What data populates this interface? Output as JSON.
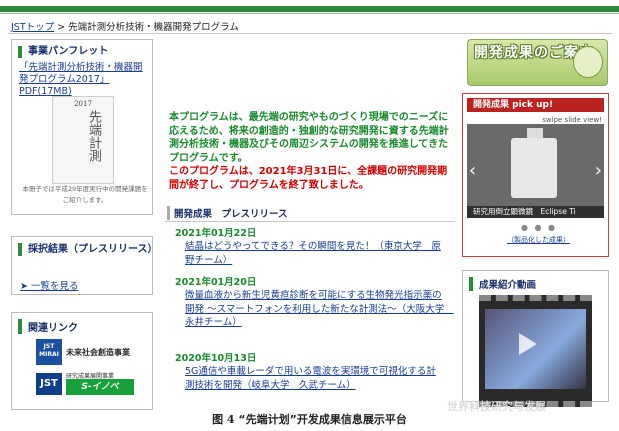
{
  "breadcrumb": {
    "home": "JSTトップ",
    "sep": " > ",
    "current": "先端計測分析技術・機器開発プログラム"
  },
  "left": {
    "pamphlet": {
      "title": "事業パンフレット",
      "link": "「先端計測分析技術・機器開発プログラム2017」 PDF(17MB)",
      "cover_year": "2017",
      "cover_text": "先端計測",
      "note": "本冊子では平成29年度実行中の開発課題をご紹介します。"
    },
    "results": {
      "title": "採択結果（プレスリリース）",
      "link": "➤ 一覧を見る"
    },
    "links": {
      "title": "関連リンク",
      "banner1_logo": "JST MIRAI",
      "banner1_text": "未来社会創造事業",
      "banner2_logo": "JST",
      "banner2_top": "研究成果展開事業",
      "banner2_text": "S-イノベ"
    }
  },
  "center": {
    "intro": "本プログラムは、最先端の研究やものづくり現場でのニーズに応えるため、将来の創造的・独創的な研究開発に資する先端計測分析技術・機器及びその周辺システムの開発を推進してきたプログラムです。",
    "notice": "このプログラムは、2021年3月31日に、全課題の研究開発期間が終了し、プログラムを終了致しました。",
    "section_title": "開発成果　プレスリリース",
    "news": [
      {
        "date": "2021年01月22日",
        "text": "結晶はどうやってできる？その瞬間を見た！（東京大学　原野チーム）"
      },
      {
        "date": "2021年01月20日",
        "text": "微量血液から新生児黄疸診断を可能にする生物発光指示薬の開発 ～スマートフォンを利用した新たな計測法～（大阪大学　永井チーム）"
      },
      {
        "date": "2020年10月13日",
        "text": "5G通信や車載レーダで用いる電波を実環境で可視化する計測技術を開発（岐阜大学　久武チーム）"
      }
    ]
  },
  "right": {
    "banner": "開発成果のご案内",
    "pickup": {
      "title": "開発成果 pick up!",
      "swipe": "swipe slide view!",
      "caption": "研究用倒立顕微鏡　Eclipse Ti",
      "dots": "● ● ●",
      "link": "（製品化した成果）"
    },
    "video": {
      "title": "成果紹介動画"
    }
  },
  "watermark": "世界科技研究与发展",
  "caption": {
    "fig": "图 4",
    "text": "“先端计划”开发成果信息展示平台"
  },
  "colors": {
    "accent_green": "#2e8b3c",
    "notice_red": "#d40000",
    "link_blue": "#1a3d99"
  }
}
